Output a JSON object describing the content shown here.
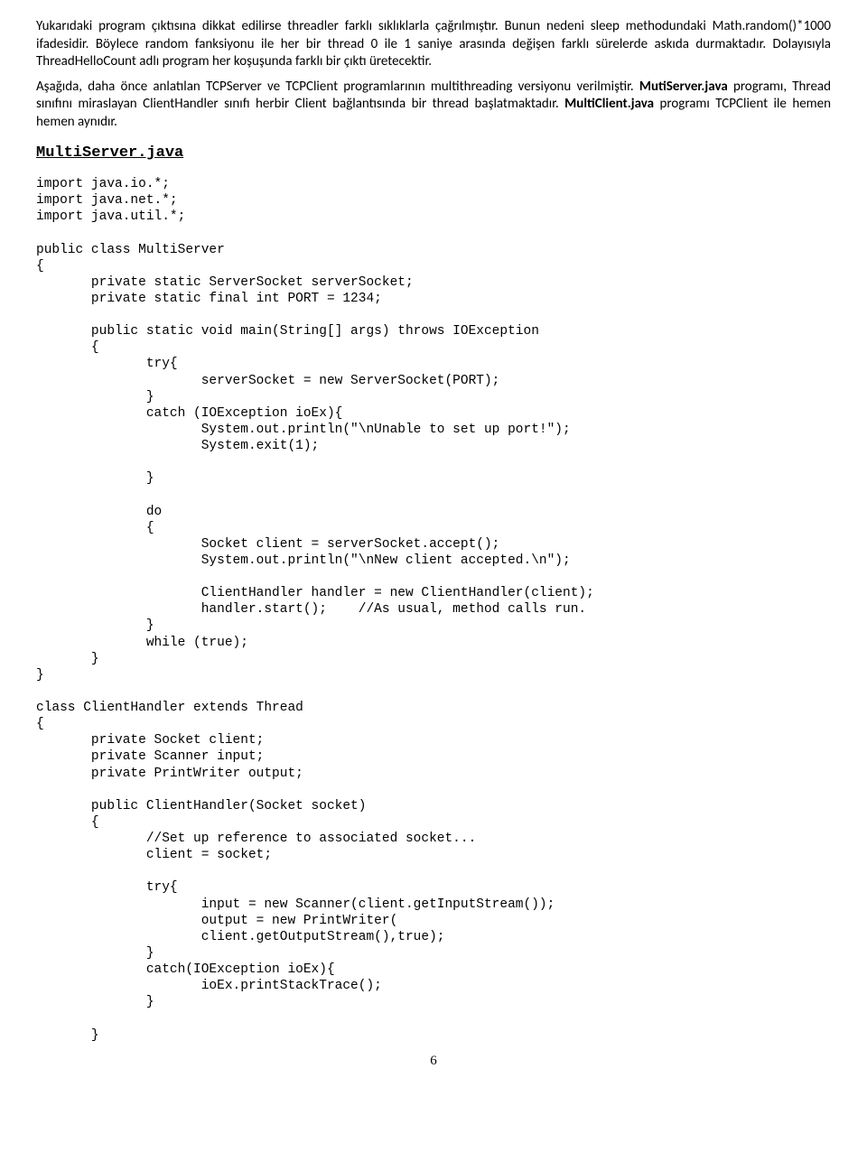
{
  "paragraphs": {
    "p1": "Yukarıdaki program çıktısına dikkat edilirse threadler farklı sıklıklarla çağrılmıştır. Bunun nedeni sleep methodundaki Math.random()*1000 ifadesidir. Böylece random fanksiyonu ile her bir thread 0 ile 1 saniye arasında değişen farklı sürelerde askıda durmaktadır. Dolayısıyla ThreadHelloCount adlı program her koşuşunda farklı bir çıktı üretecektir.",
    "p2_part1": "Aşağıda, daha önce anlatılan TCPServer ve TCPClient programlarının multithreading versiyonu verilmiştir. ",
    "p2_bold1": "MutiServer.java",
    "p2_part2": " programı, Thread sınıfını miraslayan ClientHandler sınıfı herbir Client bağlantısında bir thread başlatmaktadır. ",
    "p2_bold2": "MultiClient.java",
    "p2_part3": " programı TCPClient ile hemen hemen aynıdır."
  },
  "heading": "MultiServer.java",
  "code": "import java.io.*;\nimport java.net.*;\nimport java.util.*;\n\npublic class MultiServer\n{\n       private static ServerSocket serverSocket;\n       private static final int PORT = 1234;\n\n       public static void main(String[] args) throws IOException\n       {\n              try{\n                     serverSocket = new ServerSocket(PORT);\n              }\n              catch (IOException ioEx){\n                     System.out.println(\"\\nUnable to set up port!\");\n                     System.exit(1);\n\n              }\n\n              do\n              {\n                     Socket client = serverSocket.accept();\n                     System.out.println(\"\\nNew client accepted.\\n\");\n\n                     ClientHandler handler = new ClientHandler(client);\n                     handler.start();    //As usual, method calls run.\n              }\n              while (true);\n       }\n}\n\nclass ClientHandler extends Thread\n{\n       private Socket client;\n       private Scanner input;\n       private PrintWriter output;\n\n       public ClientHandler(Socket socket)\n       {\n              //Set up reference to associated socket...\n              client = socket;\n\n              try{\n                     input = new Scanner(client.getInputStream());\n                     output = new PrintWriter(\n                     client.getOutputStream(),true);\n              }\n              catch(IOException ioEx){\n                     ioEx.printStackTrace();\n              }\n\n       }",
  "pagenum": "6"
}
